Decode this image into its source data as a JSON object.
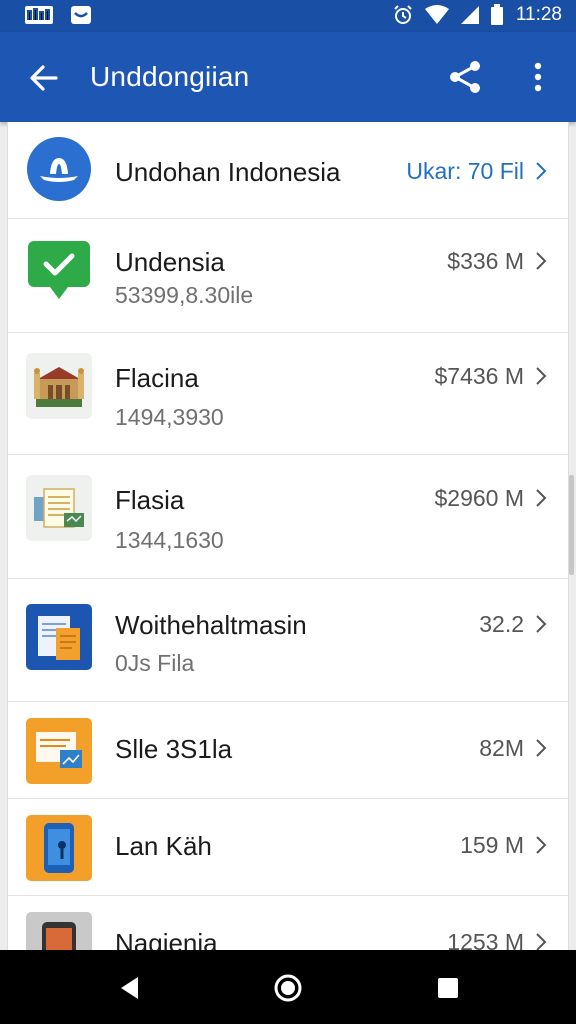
{
  "status_bar": {
    "time": "11:28",
    "left_icons": [
      "photos-notification-icon",
      "message-notification-icon"
    ],
    "right_icons": [
      "alarm-icon",
      "wifi-icon",
      "signal-icon",
      "battery-icon"
    ]
  },
  "app_bar": {
    "title": "Unddongiian",
    "back_icon": "arrow-left-icon",
    "share_icon": "share-icon",
    "more_icon": "more-vertical-icon"
  },
  "items": [
    {
      "name": "Undohan Indonesia",
      "sub": "",
      "value": "Ukar: 70 Fil",
      "icon": "blue-circle-logo-icon",
      "value_color": "#2270c4"
    },
    {
      "name": "Undensia",
      "sub": "53399,8.30ile",
      "value": "$336 M",
      "icon": "green-check-chat-icon"
    },
    {
      "name": "Flacina",
      "sub": "1494,3930",
      "value": "$7436 M",
      "icon": "building-illustration-icon"
    },
    {
      "name": "Flasia",
      "sub": "1344,1630",
      "value": "$2960 M",
      "icon": "documents-illustration-icon"
    },
    {
      "name": "Woithehaltmasin",
      "sub": "0Js Fila",
      "value": "32.2",
      "icon": "blue-files-icon"
    },
    {
      "name": "Slle 3S1la",
      "sub": "",
      "value": "82M",
      "icon": "orange-window-icon"
    },
    {
      "name": "Lan Käh",
      "sub": "",
      "value": "159 M",
      "icon": "orange-phone-icon"
    },
    {
      "name": "Nagienia",
      "sub": "",
      "value": "1253 M",
      "icon": "gray-phone-icon"
    }
  ],
  "colors": {
    "status_bar": "#1a4fa6",
    "app_bar": "#1e56b4",
    "link": "#2270c4",
    "nav_bar": "#000000"
  },
  "nav_bar": {
    "icons": [
      "back-triangle-icon",
      "home-circle-icon",
      "recents-square-icon"
    ]
  }
}
